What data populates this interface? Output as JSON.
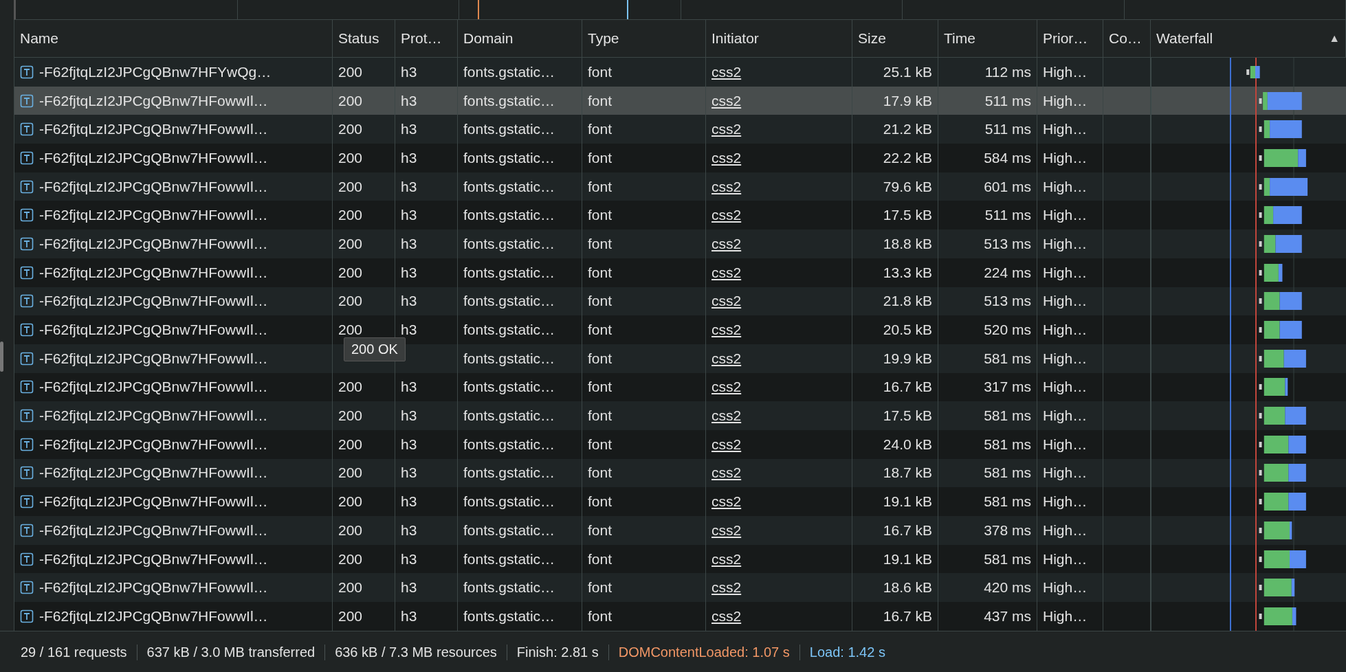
{
  "columns": [
    {
      "label": "Name"
    },
    {
      "label": "Status"
    },
    {
      "label": "Prot…"
    },
    {
      "label": "Domain"
    },
    {
      "label": "Type"
    },
    {
      "label": "Initiator"
    },
    {
      "label": "Size"
    },
    {
      "label": "Time"
    },
    {
      "label": "Prior…"
    },
    {
      "label": "Co…"
    },
    {
      "label": "Waterfall"
    }
  ],
  "sort_indicator": "▲",
  "rows": [
    {
      "name": "-F62fjtqLzI2JPCgQBnw7HFYwQg…",
      "status": "200",
      "protocol": "h3",
      "domain": "fonts.gstatic…",
      "type": "font",
      "initiator": "css2",
      "size": "25.1 kB",
      "time": "112 ms",
      "priority": "High…",
      "selected": false
    },
    {
      "name": "-F62fjtqLzI2JPCgQBnw7HFowwIl…",
      "status": "200",
      "protocol": "h3",
      "domain": "fonts.gstatic…",
      "type": "font",
      "initiator": "css2",
      "size": "17.9 kB",
      "time": "511 ms",
      "priority": "High…",
      "selected": true
    },
    {
      "name": "-F62fjtqLzI2JPCgQBnw7HFowwIl…",
      "status": "200",
      "protocol": "h3",
      "domain": "fonts.gstatic…",
      "type": "font",
      "initiator": "css2",
      "size": "21.2 kB",
      "time": "511 ms",
      "priority": "High…",
      "selected": false
    },
    {
      "name": "-F62fjtqLzI2JPCgQBnw7HFowwIl…",
      "status": "200",
      "protocol": "h3",
      "domain": "fonts.gstatic…",
      "type": "font",
      "initiator": "css2",
      "size": "22.2 kB",
      "time": "584 ms",
      "priority": "High…",
      "selected": false
    },
    {
      "name": "-F62fjtqLzI2JPCgQBnw7HFowwIl…",
      "status": "200",
      "protocol": "h3",
      "domain": "fonts.gstatic…",
      "type": "font",
      "initiator": "css2",
      "size": "79.6 kB",
      "time": "601 ms",
      "priority": "High…",
      "selected": false
    },
    {
      "name": "-F62fjtqLzI2JPCgQBnw7HFowwIl…",
      "status": "200",
      "protocol": "h3",
      "domain": "fonts.gstatic…",
      "type": "font",
      "initiator": "css2",
      "size": "17.5 kB",
      "time": "511 ms",
      "priority": "High…",
      "selected": false
    },
    {
      "name": "-F62fjtqLzI2JPCgQBnw7HFowwIl…",
      "status": "200",
      "protocol": "h3",
      "domain": "fonts.gstatic…",
      "type": "font",
      "initiator": "css2",
      "size": "18.8 kB",
      "time": "513 ms",
      "priority": "High…",
      "selected": false
    },
    {
      "name": "-F62fjtqLzI2JPCgQBnw7HFowwIl…",
      "status": "200",
      "protocol": "h3",
      "domain": "fonts.gstatic…",
      "type": "font",
      "initiator": "css2",
      "size": "13.3 kB",
      "time": "224 ms",
      "priority": "High…",
      "selected": false
    },
    {
      "name": "-F62fjtqLzI2JPCgQBnw7HFowwIl…",
      "status": "200",
      "protocol": "h3",
      "domain": "fonts.gstatic…",
      "type": "font",
      "initiator": "css2",
      "size": "21.8 kB",
      "time": "513 ms",
      "priority": "High…",
      "selected": false
    },
    {
      "name": "-F62fjtqLzI2JPCgQBnw7HFowwIl…",
      "status": "200",
      "protocol": "h3",
      "domain": "fonts.gstatic…",
      "type": "font",
      "initiator": "css2",
      "size": "20.5 kB",
      "time": "520 ms",
      "priority": "High…",
      "selected": false
    },
    {
      "name": "-F62fjtqLzI2JPCgQBnw7HFowwIl…",
      "domain": "fonts.gstatic…",
      "type": "font",
      "initiator": "css2",
      "size": "19.9 kB",
      "time": "581 ms",
      "priority": "High…",
      "selected": false
    },
    {
      "name": "-F62fjtqLzI2JPCgQBnw7HFowwIl…",
      "status": "200",
      "protocol": "h3",
      "domain": "fonts.gstatic…",
      "type": "font",
      "initiator": "css2",
      "size": "16.7 kB",
      "time": "317 ms",
      "priority": "High…",
      "selected": false
    },
    {
      "name": "-F62fjtqLzI2JPCgQBnw7HFowwIl…",
      "status": "200",
      "protocol": "h3",
      "domain": "fonts.gstatic…",
      "type": "font",
      "initiator": "css2",
      "size": "17.5 kB",
      "time": "581 ms",
      "priority": "High…",
      "selected": false
    },
    {
      "name": "-F62fjtqLzI2JPCgQBnw7HFowwIl…",
      "status": "200",
      "protocol": "h3",
      "domain": "fonts.gstatic…",
      "type": "font",
      "initiator": "css2",
      "size": "24.0 kB",
      "time": "581 ms",
      "priority": "High…",
      "selected": false
    },
    {
      "name": "-F62fjtqLzI2JPCgQBnw7HFowwIl…",
      "status": "200",
      "protocol": "h3",
      "domain": "fonts.gstatic…",
      "type": "font",
      "initiator": "css2",
      "size": "18.7 kB",
      "time": "581 ms",
      "priority": "High…",
      "selected": false
    },
    {
      "name": "-F62fjtqLzI2JPCgQBnw7HFowwIl…",
      "status": "200",
      "protocol": "h3",
      "domain": "fonts.gstatic…",
      "type": "font",
      "initiator": "css2",
      "size": "19.1 kB",
      "time": "581 ms",
      "priority": "High…",
      "selected": false
    },
    {
      "name": "-F62fjtqLzI2JPCgQBnw7HFowwIl…",
      "status": "200",
      "protocol": "h3",
      "domain": "fonts.gstatic…",
      "type": "font",
      "initiator": "css2",
      "size": "16.7 kB",
      "time": "378 ms",
      "priority": "High…",
      "selected": false
    },
    {
      "name": "-F62fjtqLzI2JPCgQBnw7HFowwIl…",
      "status": "200",
      "protocol": "h3",
      "domain": "fonts.gstatic…",
      "type": "font",
      "initiator": "css2",
      "size": "19.1 kB",
      "time": "581 ms",
      "priority": "High…",
      "selected": false
    },
    {
      "name": "-F62fjtqLzI2JPCgQBnw7HFowwIl…",
      "status": "200",
      "protocol": "h3",
      "domain": "fonts.gstatic…",
      "type": "font",
      "initiator": "css2",
      "size": "18.6 kB",
      "time": "420 ms",
      "priority": "High…",
      "selected": false
    },
    {
      "name": "-F62fjtqLzI2JPCgQBnw7HFowwIl…",
      "status": "200",
      "protocol": "h3",
      "domain": "fonts.gstatic…",
      "type": "font",
      "initiator": "css2",
      "size": "16.7 kB",
      "time": "437 ms",
      "priority": "High…",
      "selected": false
    }
  ],
  "tooltip": {
    "text": "200 OK"
  },
  "status_bar": [
    {
      "text": "29 / 161 requests",
      "kind": "plain"
    },
    {
      "text": "637 kB / 3.0 MB transferred",
      "kind": "plain"
    },
    {
      "text": "636 kB / 7.3 MB resources",
      "kind": "plain"
    },
    {
      "text": "Finish: 2.81 s",
      "kind": "plain"
    },
    {
      "text": "DOMContentLoaded: 1.07 s",
      "kind": "dcl"
    },
    {
      "text": "Load: 1.42 s",
      "kind": "load"
    }
  ]
}
